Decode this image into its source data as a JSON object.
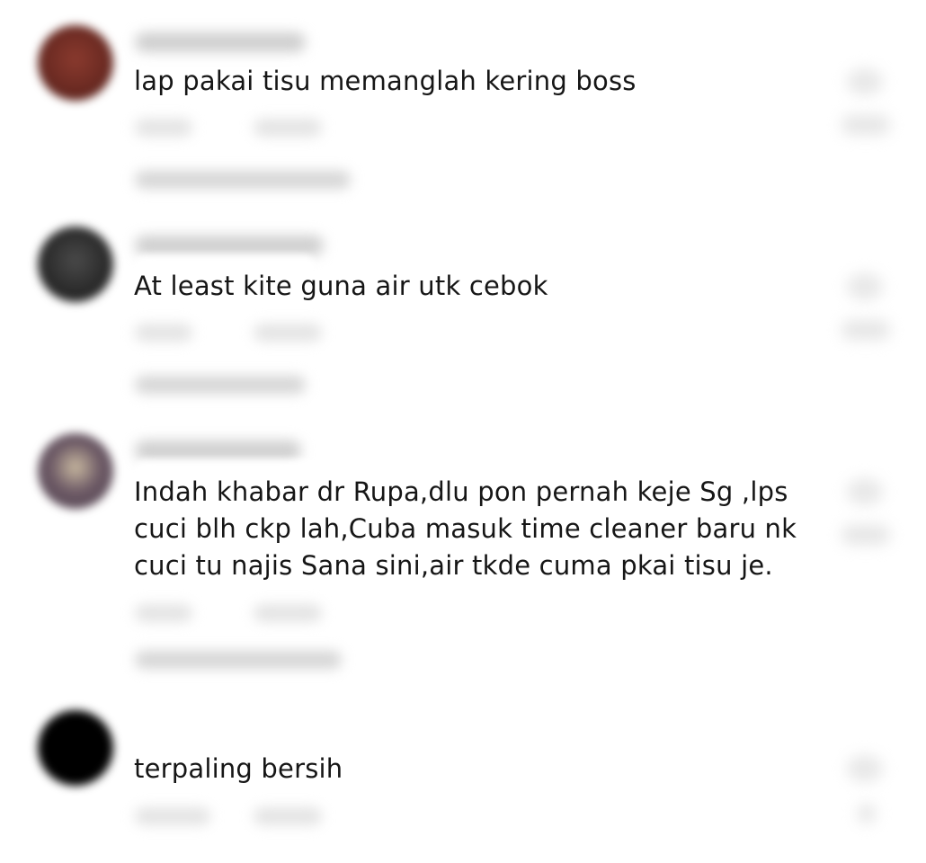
{
  "comments": [
    {
      "text": "lap pakai tisu memanglah kering boss"
    },
    {
      "text": "At least kite guna air utk cebok"
    },
    {
      "text": "Indah khabar dr Rupa,dlu pon pernah keje Sg ,lps\ncuci blh ckp lah,Cuba masuk time cleaner baru nk\ncuci tu najis Sana sini,air tkde cuma pkai tisu je."
    },
    {
      "text": "terpaling bersih"
    }
  ],
  "colors": {
    "background": "#ffffff",
    "text": "#161616",
    "avatar_1": "#6b2a22",
    "avatar_2": "#2b2b2b",
    "avatar_3": "#6d5a66",
    "avatar_4": "#000000"
  }
}
